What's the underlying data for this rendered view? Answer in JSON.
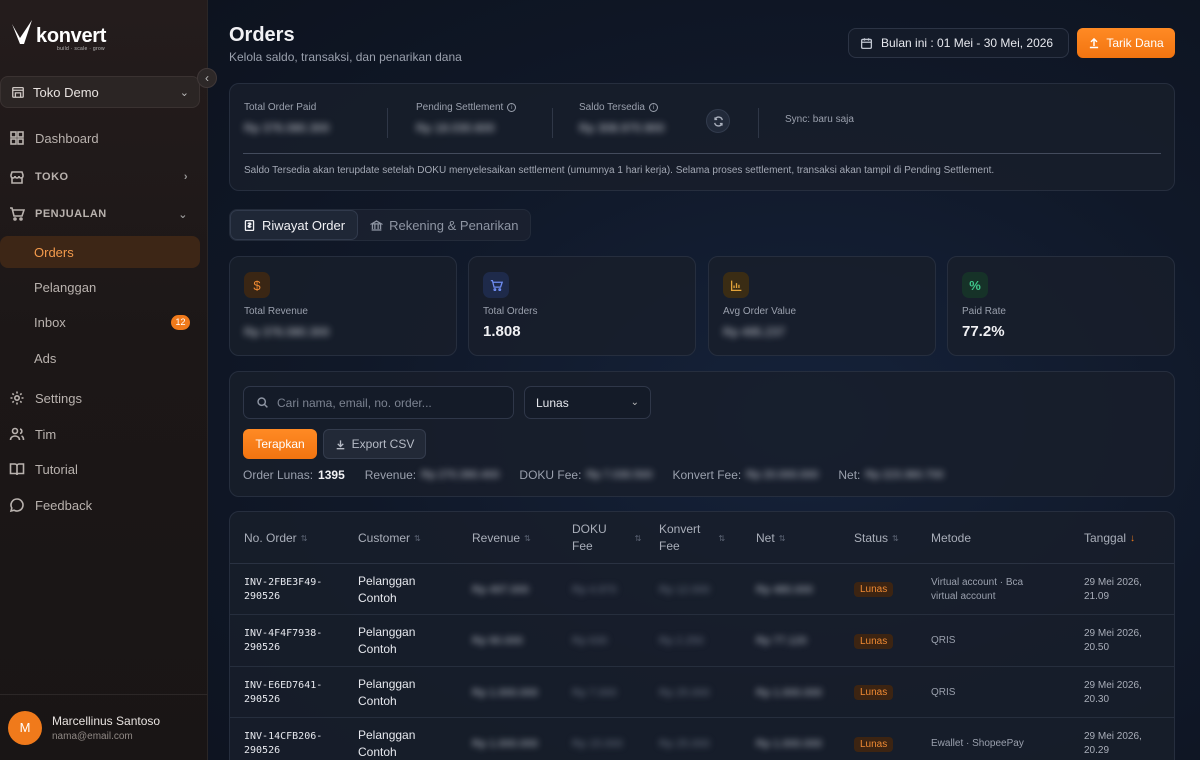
{
  "brand": {
    "name": "konvert",
    "tagline": "build · scale · grow",
    "accent": "#f07a1b"
  },
  "sidebar": {
    "store": "Toko Demo",
    "items": {
      "dashboard": "Dashboard",
      "toko": "TOKO",
      "penjualan": "PENJUALAN",
      "orders": "Orders",
      "pelanggan": "Pelanggan",
      "inbox": "Inbox",
      "inbox_count": "12",
      "ads": "Ads",
      "settings": "Settings",
      "tim": "Tim",
      "tutorial": "Tutorial",
      "feedback": "Feedback"
    },
    "user": {
      "initial": "M",
      "name": "Marcellinus Santoso",
      "email": "nama@email.com"
    }
  },
  "header": {
    "title": "Orders",
    "subtitle": "Kelola saldo, transaksi, dan penarikan dana",
    "date_range": "Bulan ini : 01 Mei - 30 Mei, 2026",
    "withdraw_label": "Tarik Dana"
  },
  "balance": {
    "total_paid_label": "Total Order Paid",
    "total_paid_value": "Rp 376.080.300",
    "pending_label": "Pending Settlement",
    "pending_value": "Rp 18.030.600",
    "saldo_label": "Saldo Tersedia",
    "saldo_value": "Rp 308.970.900",
    "sync": "Sync: baru saja",
    "note": "Saldo Tersedia akan terupdate setelah DOKU menyelesaikan settlement (umumnya 1 hari kerja). Selama proses settlement, transaksi akan tampil di Pending Settlement."
  },
  "tabs": {
    "orders": "Riwayat Order",
    "accounts": "Rekening & Penarikan"
  },
  "stats": {
    "revenue_label": "Total Revenue",
    "revenue_value": "Rp 376.080.300",
    "orders_label": "Total Orders",
    "orders_value": "1.808",
    "aov_label": "Avg Order Value",
    "aov_value": "Rp 495.237",
    "paid_rate_label": "Paid Rate",
    "paid_rate_value": "77.2%"
  },
  "filters": {
    "search_placeholder": "Cari nama, email, no. order...",
    "status": "Lunas",
    "apply": "Terapkan",
    "export": "Export CSV",
    "paid_label": "Order Lunas:",
    "paid_count": "1395",
    "revenue_label": "Revenue:",
    "revenue_value": "Rp 270.390.400",
    "doku_label": "DOKU Fee:",
    "doku_value": "Rp 7.030.500",
    "konvert_label": "Konvert Fee:",
    "konvert_value": "Rp 20.000.000",
    "net_label": "Net:",
    "net_value": "Rp 223.360.700"
  },
  "table": {
    "headers": {
      "order": "No. Order",
      "customer": "Customer",
      "revenue": "Revenue",
      "doku": "DOKU\nFee",
      "konvert": "Konvert\nFee",
      "net": "Net",
      "status": "Status",
      "method": "Metode",
      "date": "Tanggal"
    },
    "rows": [
      {
        "order": "INV-2FBE3F49-\n290526",
        "customer": "Pelanggan\nContoh",
        "revenue": "Rp 497.000",
        "doku": "Rp 4.970",
        "konvert": "Rp 12.000",
        "net": "Rp 480.000",
        "status": "Lunas",
        "method": "Virtual account · Bca\nvirtual account",
        "date": "29 Mei 2026,\n21.09"
      },
      {
        "order": "INV-4F4F7938-\n290526",
        "customer": "Pelanggan\nContoh",
        "revenue": "Rp 90.000",
        "doku": "Rp 630",
        "konvert": "Rp 2.250",
        "net": "Rp 77.120",
        "status": "Lunas",
        "method": "QRIS",
        "date": "29 Mei 2026,\n20.50"
      },
      {
        "order": "INV-E6ED7641-\n290526",
        "customer": "Pelanggan\nContoh",
        "revenue": "Rp 1.000.000",
        "doku": "Rp 7.000",
        "konvert": "Rp 25.000",
        "net": "Rp 1.000.000",
        "status": "Lunas",
        "method": "QRIS",
        "date": "29 Mei 2026,\n20.30"
      },
      {
        "order": "INV-14CFB206-\n290526",
        "customer": "Pelanggan\nContoh",
        "revenue": "Rp 1.000.000",
        "doku": "Rp 15.000",
        "konvert": "Rp 25.000",
        "net": "Rp 1.000.000",
        "status": "Lunas",
        "method": "Ewallet · ShopeePay",
        "date": "29 Mei 2026,\n20.29"
      }
    ]
  }
}
